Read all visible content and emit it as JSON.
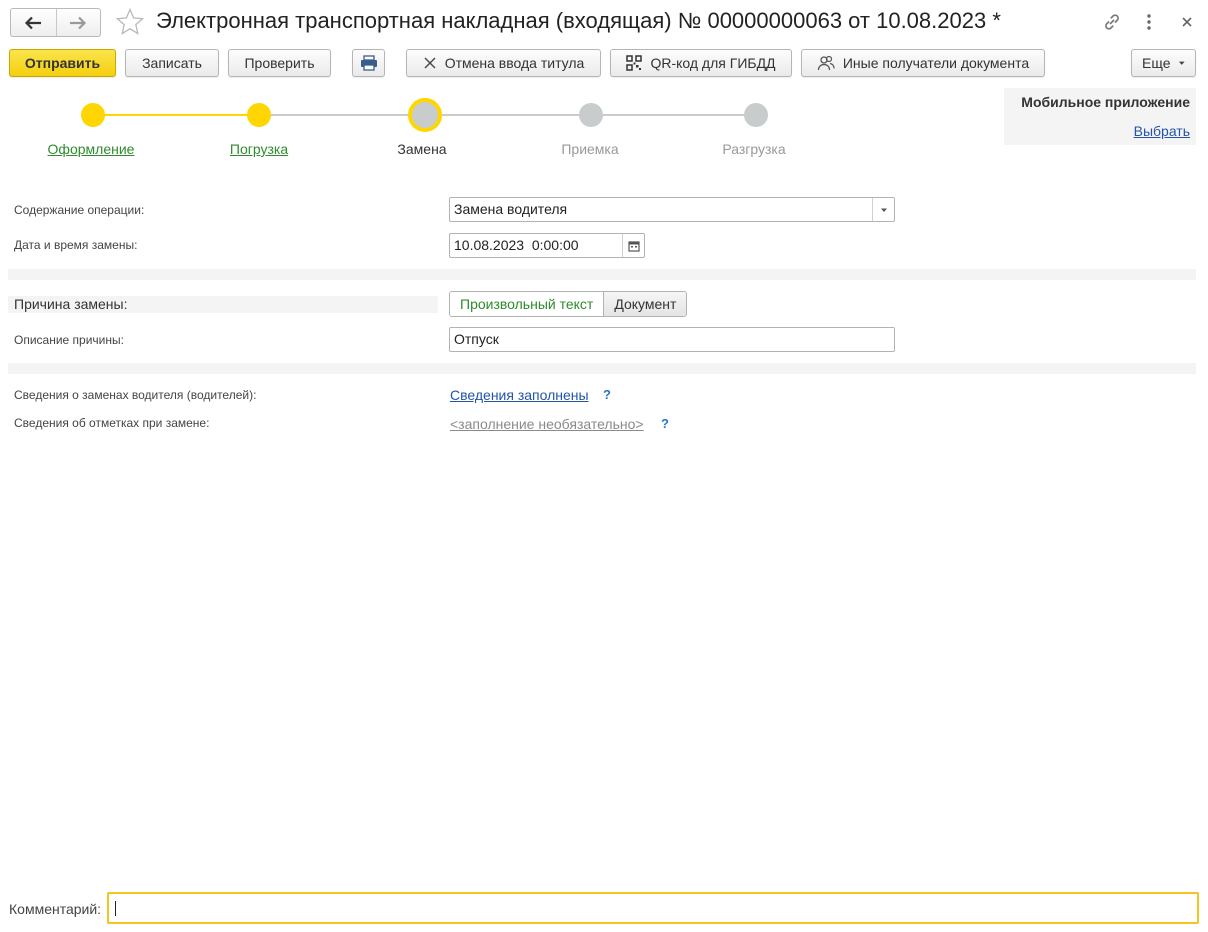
{
  "window": {
    "title": "Электронная транспортная накладная (входящая) № 00000000063 от 10.08.2023 *",
    "nav": {
      "back_icon": "arrow-left-icon",
      "forward_icon": "arrow-right-icon"
    },
    "favorite_icon": "star-icon",
    "actions": {
      "link_icon": "link-icon",
      "more_icon": "vertical-dots-icon",
      "close_icon": "close-icon"
    }
  },
  "toolbar": {
    "send": "Отправить",
    "save": "Записать",
    "check": "Проверить",
    "print_icon": "printer-icon",
    "cancel_title": "Отмена ввода титула",
    "qr": "QR-код для ГИБДД",
    "recipients": "Иные получатели документа",
    "more": "Еще"
  },
  "stepper": {
    "steps": [
      {
        "label": "Оформление",
        "state": "done"
      },
      {
        "label": "Погрузка",
        "state": "done"
      },
      {
        "label": "Замена",
        "state": "current"
      },
      {
        "label": "Приемка",
        "state": "future"
      },
      {
        "label": "Разгрузка",
        "state": "future"
      }
    ],
    "colors": {
      "done": "#FFD600",
      "future": "#C8CCCC",
      "done_line": "#FFD600",
      "future_line": "#C8CCCC"
    }
  },
  "mobile": {
    "title": "Мобильное приложение",
    "link": "Выбрать"
  },
  "form": {
    "operation_label": "Содержание операции:",
    "operation_value": "Замена водителя",
    "datetime_label": "Дата и время замены:",
    "datetime_value": "10.08.2023  0:00:00",
    "reason_label": "Причина замены:",
    "reason_modes": {
      "free_text": "Произвольный текст",
      "document": "Документ",
      "selected": "free_text"
    },
    "reason_desc_label": "Описание причины:",
    "reason_desc_value": "Отпуск",
    "driver_changes_label": "Сведения о заменах водителя (водителей):",
    "driver_changes_link": "Сведения заполнены",
    "marks_label": "Сведения об отметках при замене:",
    "marks_link": "<заполнение необязательно>",
    "help": "?"
  },
  "comment": {
    "label": "Комментарий:",
    "value": ""
  }
}
